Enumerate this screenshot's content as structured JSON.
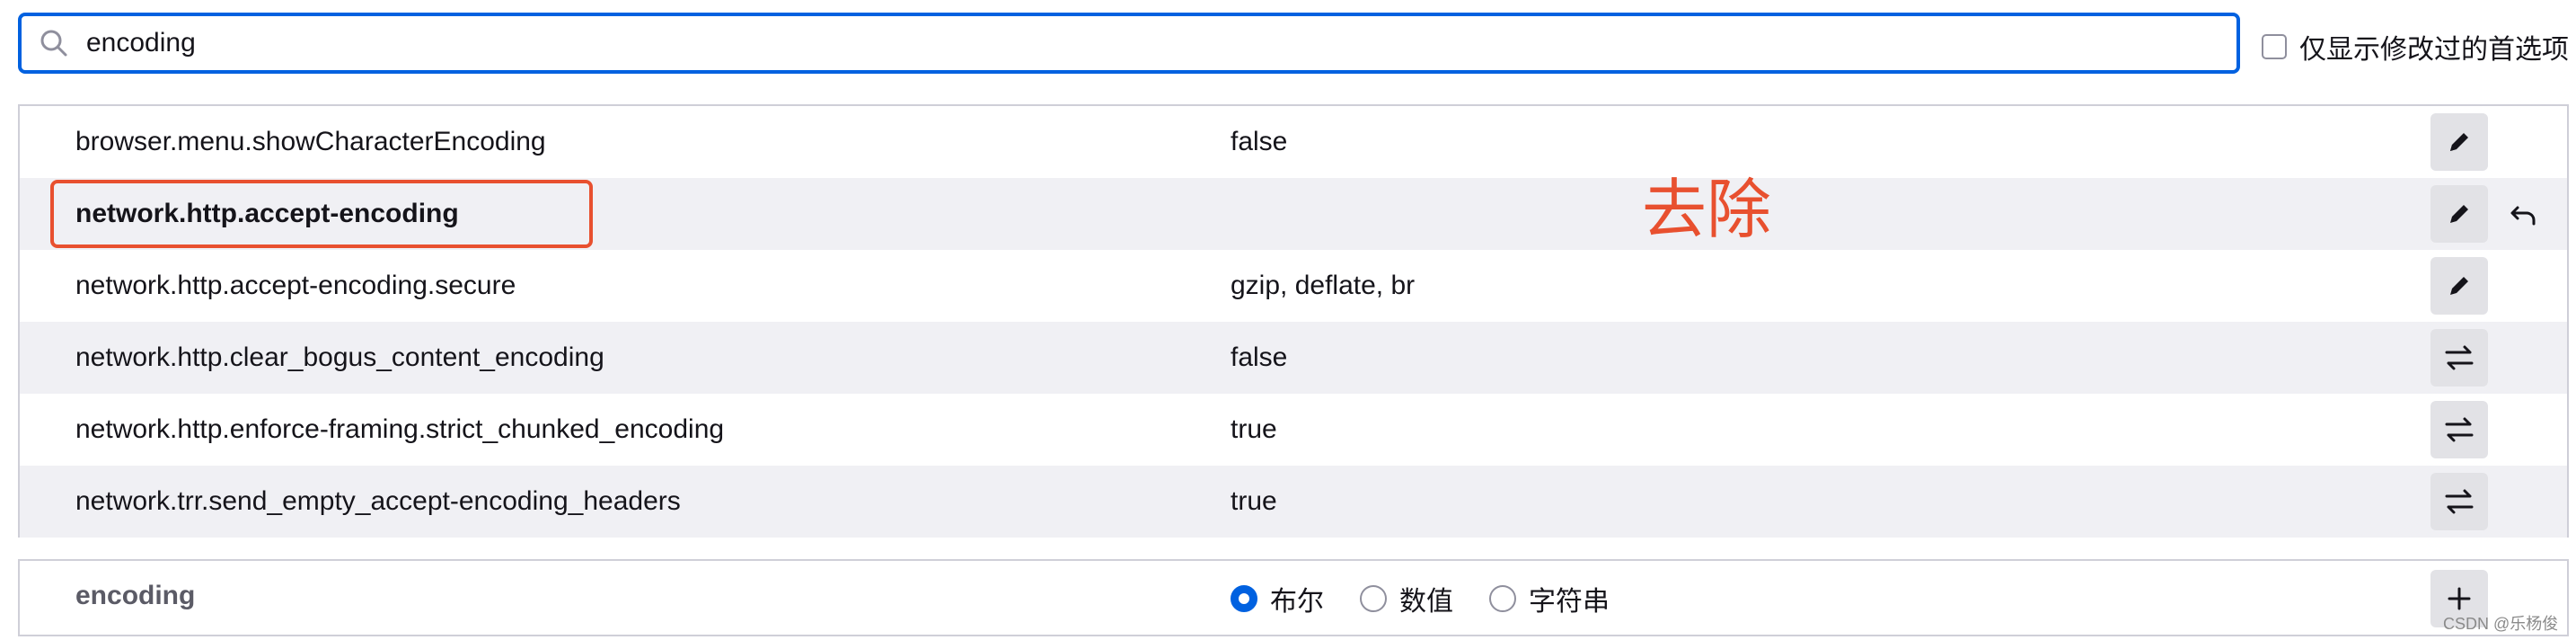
{
  "search": {
    "value": "encoding",
    "placeholder": ""
  },
  "modified_only_label": "仅显示修改过的首选项",
  "prefs": [
    {
      "name": "browser.menu.showCharacterEncoding",
      "value": "false",
      "modified": false,
      "action": "edit",
      "action_icon": "pencil-icon",
      "has_reset": false
    },
    {
      "name": "network.http.accept-encoding",
      "value": "",
      "modified": true,
      "action": "edit",
      "action_icon": "pencil-icon",
      "has_reset": true
    },
    {
      "name": "network.http.accept-encoding.secure",
      "value": "gzip, deflate, br",
      "modified": false,
      "action": "edit",
      "action_icon": "pencil-icon",
      "has_reset": false
    },
    {
      "name": "network.http.clear_bogus_content_encoding",
      "value": "false",
      "modified": false,
      "action": "toggle",
      "action_icon": "toggle-arrows-icon",
      "has_reset": false
    },
    {
      "name": "network.http.enforce-framing.strict_chunked_encoding",
      "value": "true",
      "modified": false,
      "action": "toggle",
      "action_icon": "toggle-arrows-icon",
      "has_reset": false
    },
    {
      "name": "network.trr.send_empty_accept-encoding_headers",
      "value": "true",
      "modified": false,
      "action": "toggle",
      "action_icon": "toggle-arrows-icon",
      "has_reset": false
    }
  ],
  "annotation": {
    "text": "去除",
    "color": "#e8502f"
  },
  "add_row": {
    "name": "encoding",
    "types": [
      {
        "label": "布尔",
        "checked": true
      },
      {
        "label": "数值",
        "checked": false
      },
      {
        "label": "字符串",
        "checked": false
      }
    ]
  },
  "watermark": "CSDN @乐杨俊",
  "colors": {
    "accent": "#0061e0",
    "row_alt": "#f0f0f4",
    "button_bg": "#e2e2e6",
    "annotation": "#e8502f"
  }
}
